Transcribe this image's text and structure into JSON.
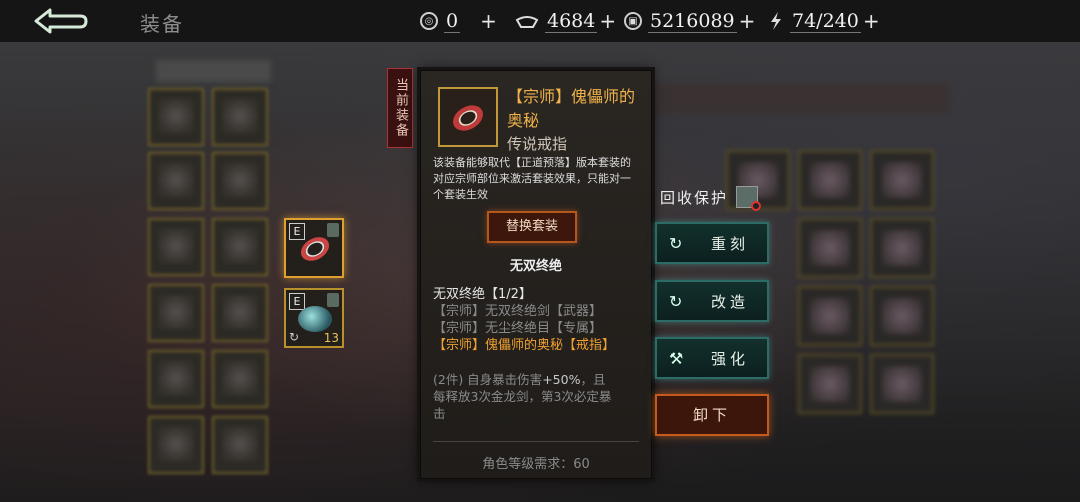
{
  "header": {
    "title": "装备",
    "resources": [
      {
        "icon": "coin-icon",
        "value": "0",
        "plus": "+"
      },
      {
        "icon": "silver-ingot-icon",
        "value": "4684",
        "plus": "+"
      },
      {
        "icon": "copper-coin-icon",
        "value": "5216089",
        "plus": "+"
      },
      {
        "icon": "lightning-icon",
        "value": "74/240",
        "plus": "+"
      }
    ]
  },
  "current_tag": "当前装备",
  "slots": [
    {
      "badge": "E",
      "icon": "ring-icon"
    },
    {
      "badge": "E",
      "icon": "orb-icon",
      "level": "13"
    }
  ],
  "item": {
    "name": "【宗师】傀儡师的奥秘",
    "type": "传说戒指",
    "description": "该装备能够取代【正道预落】版本套装的对应宗师部位来激活套装效果，只能对一个套装生效",
    "swap_label": "替换套装",
    "set_name": "无双终绝",
    "set_header": "无双终绝【1/2】",
    "set_items": [
      "【宗师】无双终绝剑【武器】",
      "【宗师】无尘终绝目【专属】",
      "【宗师】傀儡师的奥秘【戒指】"
    ],
    "bonus_prefix": "(2件) 自身暴击伤害",
    "bonus_value": "+50%",
    "bonus_suffix": "，且每释放3次金龙剑，第3次必定暴击",
    "requirement": "角色等级需求：60"
  },
  "actions": {
    "recycle_label": "回收保护",
    "recast": "重刻",
    "reforge": "改造",
    "enhance": "强化",
    "unequip": "卸下"
  }
}
